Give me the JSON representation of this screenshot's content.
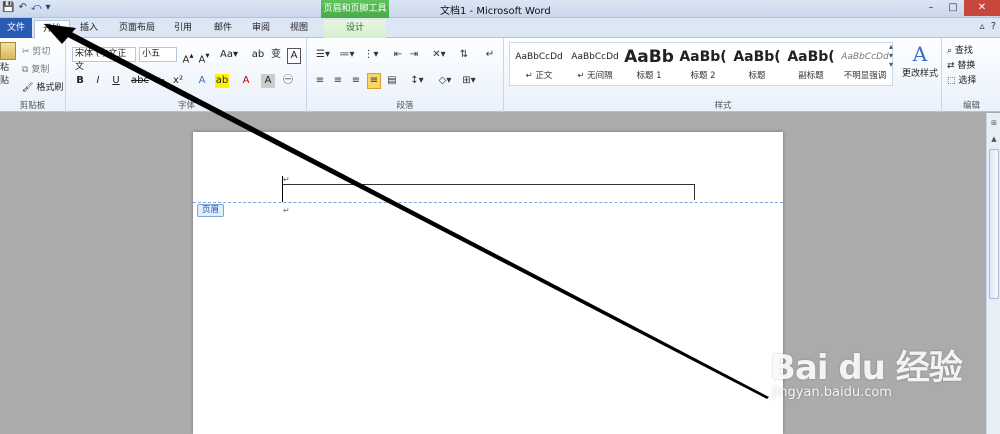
{
  "window": {
    "title": "文档1 - Microsoft Word",
    "context_tool_header": "页眉和页脚工具",
    "controls": {
      "minimize": "–",
      "maximize": "□",
      "close": "✕"
    }
  },
  "quick_access": {
    "save_icon": "save-icon",
    "undo": "↶",
    "redo": "⤺"
  },
  "tabs": [
    {
      "label": "文件",
      "type": "file"
    },
    {
      "label": "开始",
      "type": "active"
    },
    {
      "label": "插入"
    },
    {
      "label": "页面布局"
    },
    {
      "label": "引用"
    },
    {
      "label": "邮件"
    },
    {
      "label": "审阅"
    },
    {
      "label": "视图"
    },
    {
      "label": "设计",
      "type": "context"
    }
  ],
  "clipboard": {
    "paste": "粘贴",
    "cut": "剪切",
    "copy": "复制",
    "format_painter": "格式刷",
    "group_label": "剪贴板"
  },
  "font": {
    "font_name": "宋体 (中文正文",
    "font_size": "小五",
    "group_label": "字体"
  },
  "paragraph": {
    "group_label": "段落"
  },
  "styles": {
    "items": [
      {
        "sample": "AaBbCcDd",
        "name": "↵ 正文"
      },
      {
        "sample": "AaBbCcDd",
        "name": "↵ 无间隔"
      },
      {
        "sample": "AaBb",
        "name": "标题 1"
      },
      {
        "sample": "AaBb(",
        "name": "标题 2"
      },
      {
        "sample": "AaBb(",
        "name": "标题"
      },
      {
        "sample": "AaBb(",
        "name": "副标题"
      },
      {
        "sample": "AaBbCcDd",
        "name": "不明显强调"
      }
    ],
    "change_styles": "更改样式",
    "group_label": "样式"
  },
  "editing": {
    "find": "查找",
    "replace": "替换",
    "select": "选择",
    "group_label": "编辑"
  },
  "document": {
    "header_tag": "页眉",
    "para_mark": "↵"
  },
  "watermark": {
    "brand": "Bai du 经验",
    "url": "jingyan.baidu.com"
  },
  "colors": {
    "file_tab": "#2A5BB2",
    "context_tab": "#4AAA46",
    "ribbon_bg": "#EAF1FB",
    "doc_bg": "#ABABAB"
  }
}
